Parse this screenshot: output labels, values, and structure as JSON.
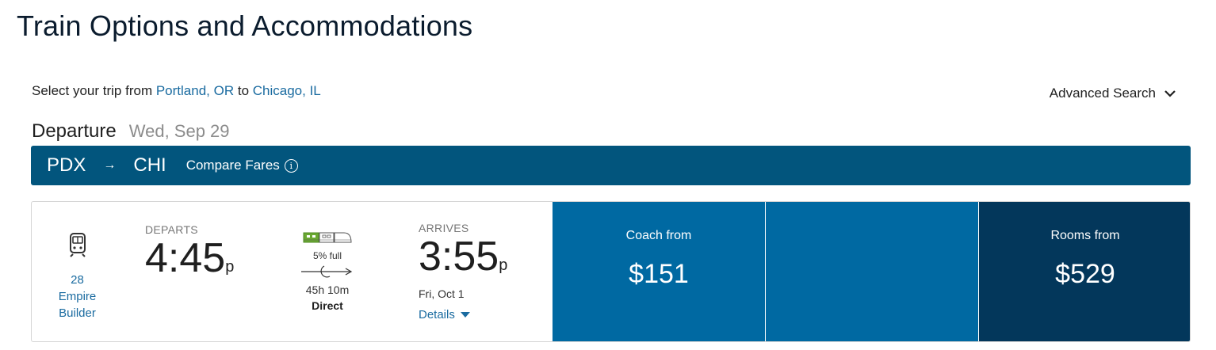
{
  "header": {
    "title": "Train Options and Accommodations"
  },
  "trip": {
    "prefix": "Select your trip from",
    "origin": "Portland, OR",
    "connector": "to",
    "destination": "Chicago, IL",
    "advanced_search_label": "Advanced Search"
  },
  "departure": {
    "label": "Departure",
    "date": "Wed, Sep 29"
  },
  "route": {
    "origin_code": "PDX",
    "arrow": "→",
    "destination_code": "CHI",
    "compare_label": "Compare Fares",
    "info_glyph": "i"
  },
  "train": {
    "number": "28",
    "name_line1": "Empire",
    "name_line2": "Builder",
    "departs_label": "DEPARTS",
    "depart_time": "4:45",
    "depart_ampm": "p",
    "capacity": "5% full",
    "capacity_fraction": 0.05,
    "duration": "45h 10m",
    "route_type": "Direct",
    "arrives_label": "ARRIVES",
    "arrive_time": "3:55",
    "arrive_ampm": "p",
    "arrive_date": "Fri, Oct 1",
    "details_label": "Details"
  },
  "fares": {
    "coach_label": "Coach from",
    "coach_price": "$151",
    "rooms_label": "Rooms from",
    "rooms_price": "$529"
  },
  "colors": {
    "route_bar": "#02557d",
    "fare_panel": "#0069a2",
    "rooms_panel": "#03375b",
    "link": "#1a6ba0",
    "capacity_green": "#6aa832"
  },
  "icons": {
    "train": "train-icon",
    "route_arrow": "arrow-right-icon",
    "info": "info-icon",
    "chevron": "chevron-down-icon",
    "capacity": "train-capacity-icon",
    "overnight": "overnight-moon-icon",
    "details_caret": "caret-down-icon"
  }
}
